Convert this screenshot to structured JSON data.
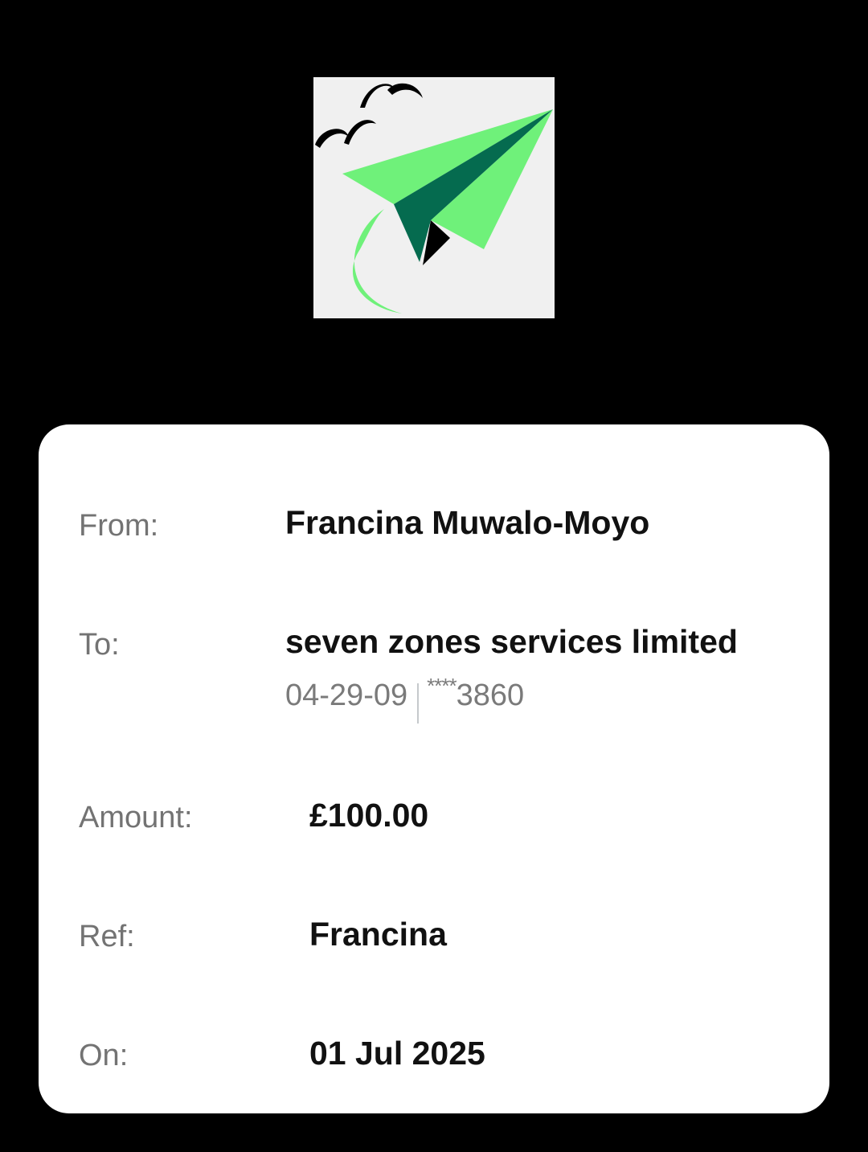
{
  "logo": {
    "icon": "paper-plane-with-birds-logo",
    "colors": {
      "background": "#f0f0f0",
      "light_green": "#6ff17a",
      "dark_green": "#056b4f",
      "black": "#000000"
    }
  },
  "receipt": {
    "from_label": "From:",
    "from_value": "Francina Muwalo-Moyo",
    "to_label": "To:",
    "to_value": "seven zones services limited",
    "sort_code": "04-29-09",
    "account_mask": "****",
    "account_suffix": "3860",
    "amount_label": "Amount:",
    "amount_value": "£100.00",
    "ref_label": "Ref:",
    "ref_value": "Francina",
    "on_label": "On:",
    "on_value": "01 Jul 2025"
  }
}
